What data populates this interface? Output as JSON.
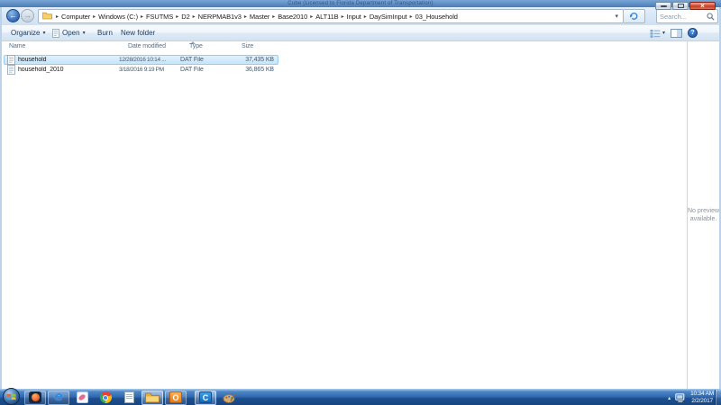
{
  "background_window": {
    "title": "Cube (Licensed to Florida Department of Transportation)"
  },
  "explorer": {
    "window_controls": {
      "close_glyph": "×"
    },
    "address": {
      "crumbs": [
        "Computer",
        "Windows (C:)",
        "FSUTMS",
        "D2",
        "NERPMAB1v3",
        "Master",
        "Base2010",
        "ALT11B",
        "Input",
        "DaySimInput",
        "03_Household"
      ]
    },
    "search": {
      "placeholder": "Search..."
    },
    "toolbar": {
      "organize_label": "Organize",
      "open_label": "Open",
      "burn_label": "Burn",
      "new_folder_label": "New folder"
    },
    "columns": {
      "name": "Name",
      "date_modified": "Date modified",
      "type": "Type",
      "size": "Size"
    },
    "files": [
      {
        "name": "household",
        "date_modified": "12/28/2016 10:14 ...",
        "type": "DAT File",
        "size": "37,435 KB",
        "state": "selected"
      },
      {
        "name": "household_2010",
        "date_modified": "3/18/2016 9:19 PM",
        "type": "DAT File",
        "size": "36,865 KB",
        "state": "normal"
      }
    ],
    "preview_pane": {
      "message_line1": "No preview",
      "message_line2": "available."
    }
  },
  "taskbar": {
    "tray": {
      "time": "10:34 AM",
      "date": "2/2/2017"
    }
  },
  "icons": {
    "back_arrow": "←",
    "forward_arrow": "→",
    "dropdown": "▾",
    "crumb_separator": "▸",
    "tray_expand": "▴",
    "help": "?",
    "ie_letter": "e",
    "outlook_letter": "O",
    "cube_letter": "C"
  },
  "colors": {
    "selection_fill": "#c6e5fa",
    "selection_border": "#97ccef",
    "taskbar_blue": "#2f68ad",
    "close_button_red": "#c13a21",
    "folder_yellow": "#f7d06b"
  }
}
